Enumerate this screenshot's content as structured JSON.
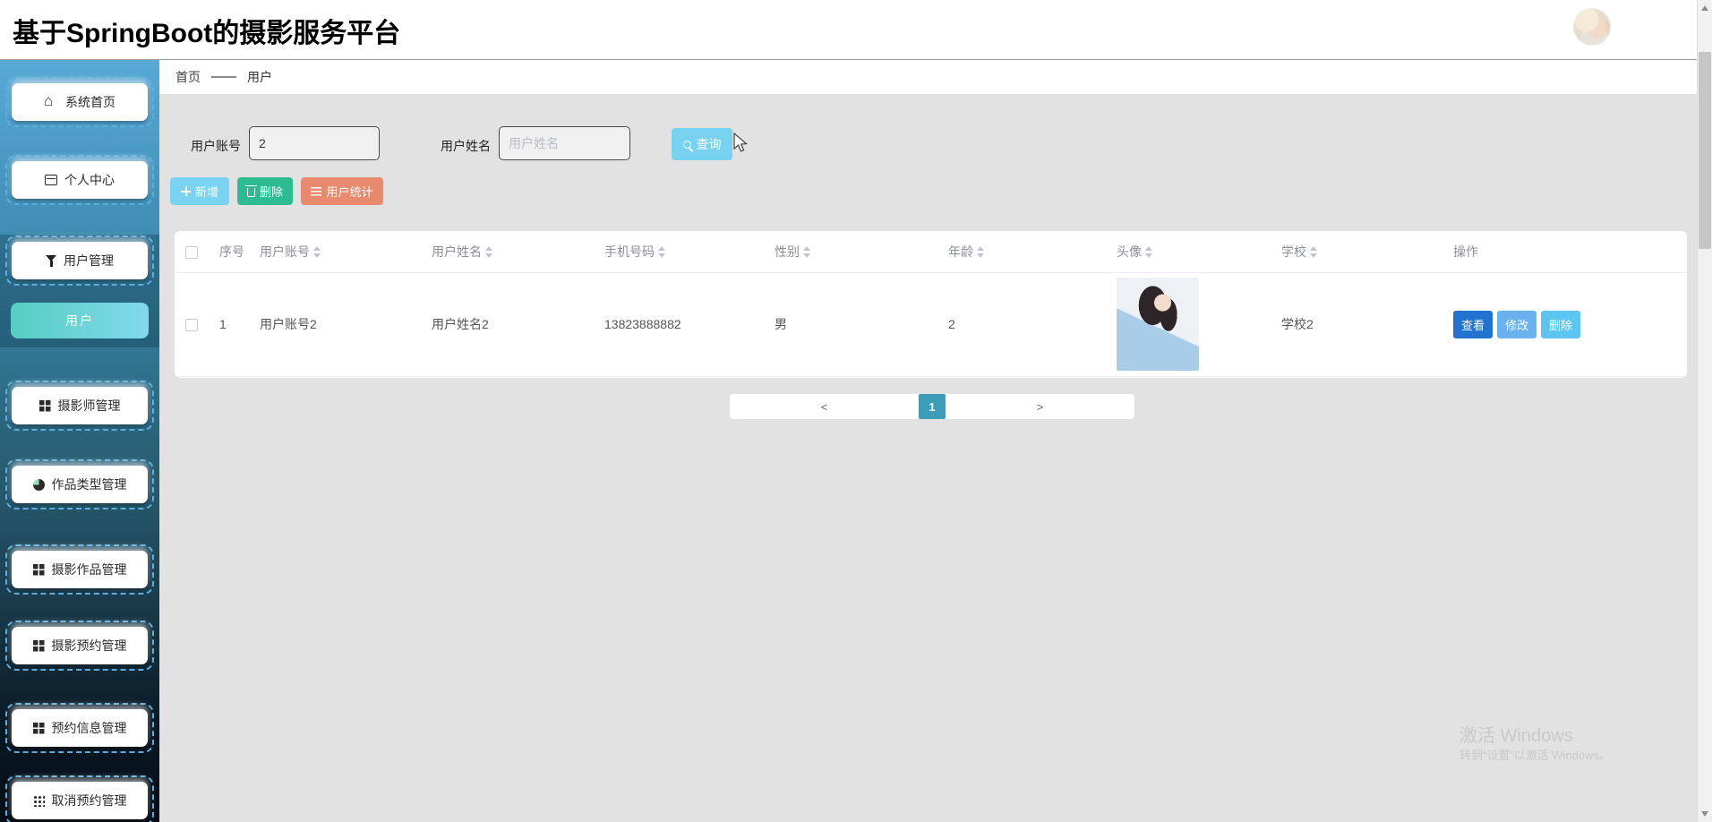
{
  "app": {
    "title": "基于SpringBoot的摄影服务平台"
  },
  "breadcrumb": {
    "home": "首页",
    "current": "用户"
  },
  "sidebar": {
    "items": [
      {
        "label": "系统首页"
      },
      {
        "label": "个人中心"
      },
      {
        "label": "用户管理"
      },
      {
        "label": "摄影师管理"
      },
      {
        "label": "作品类型管理"
      },
      {
        "label": "摄影作品管理"
      },
      {
        "label": "摄影预约管理"
      },
      {
        "label": "预约信息管理"
      },
      {
        "label": "取消预约管理"
      }
    ],
    "submenu": {
      "label": "用户"
    }
  },
  "search": {
    "account_label": "用户账号",
    "account_value": "2",
    "name_label": "用户姓名",
    "name_placeholder": "用户姓名",
    "query_label": "查询"
  },
  "toolbar": {
    "add_label": "新增",
    "delete_label": "删除",
    "stats_label": "用户统计"
  },
  "table": {
    "headers": [
      "序号",
      "用户账号",
      "用户姓名",
      "手机号码",
      "性别",
      "年龄",
      "头像",
      "学校",
      "操作"
    ],
    "rows": [
      {
        "index": "1",
        "account": "用户账号2",
        "name": "用户姓名2",
        "phone": "13823888882",
        "gender": "男",
        "age": "2",
        "school": "学校2",
        "actions": {
          "view": "查看",
          "edit": "修改",
          "remove": "删除"
        }
      }
    ]
  },
  "pagination": {
    "prev": "<",
    "page": "1",
    "next": ">"
  },
  "watermark": {
    "line1": "激活 Windows",
    "line2": "转到“设置”以激活 Windows。"
  },
  "colors": {
    "query_blue": "#76d2ef",
    "add_blue": "#79d3f1",
    "delete_green": "#2cbc90",
    "stats_salmon": "#e78a6d",
    "view_blue": "#2273cf",
    "edit_blue": "#6ab2ef",
    "row_delete_blue": "#5cc5f2",
    "pager_active_teal": "#3d9cb7"
  }
}
